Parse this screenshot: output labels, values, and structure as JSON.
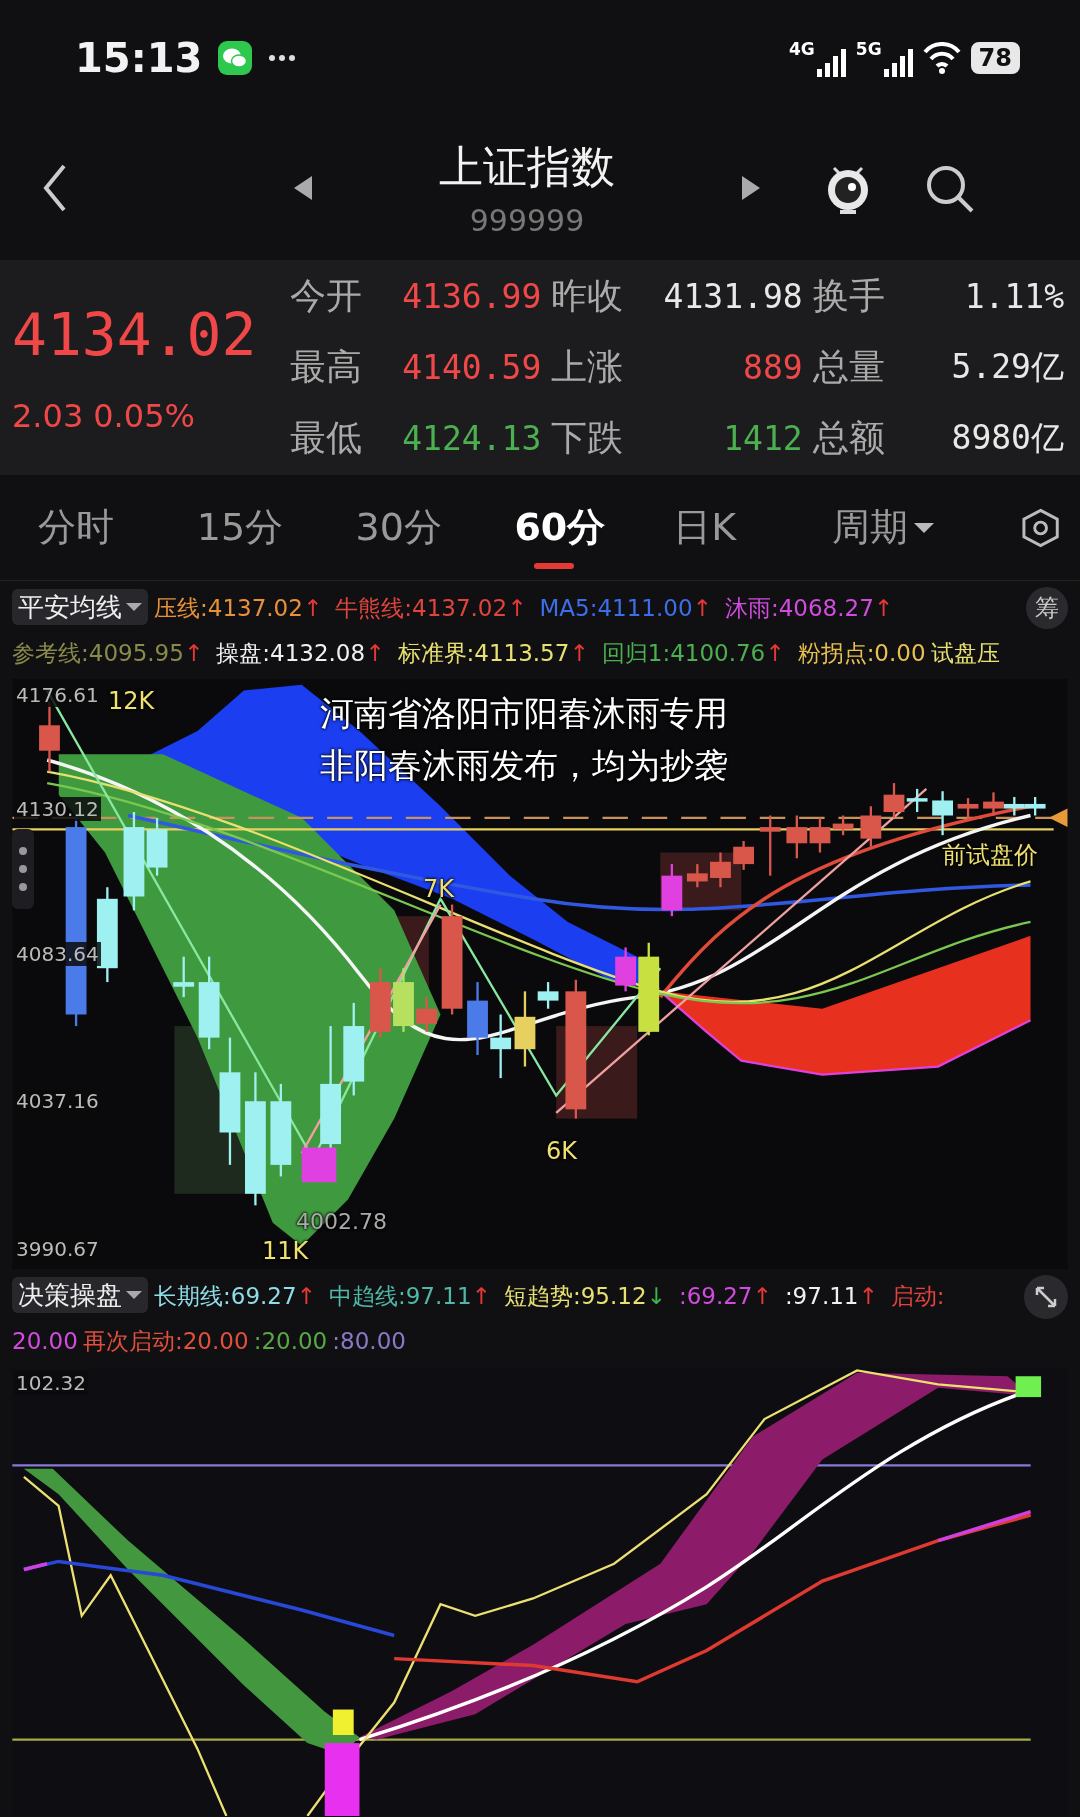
{
  "status_bar": {
    "time": "15:13",
    "network_1": "4G",
    "network_2": "5G",
    "battery": "78"
  },
  "header": {
    "title": "上证指数",
    "code": "999999"
  },
  "quote": {
    "price": "4134.02",
    "change": "2.03",
    "change_pct": "0.05%",
    "color": "#f04848",
    "stats": [
      {
        "label": "今开",
        "value": "4136.99",
        "color": "#f04848"
      },
      {
        "label": "昨收",
        "value": "4131.98",
        "color": "#e8e8e8"
      },
      {
        "label": "换手",
        "value": "1.11%",
        "color": "#e8e8e8"
      },
      {
        "label": "最高",
        "value": "4140.59",
        "color": "#f04848"
      },
      {
        "label": "上涨",
        "value": "889",
        "color": "#f04848"
      },
      {
        "label": "总量",
        "value": "5.29亿",
        "color": "#e8e8e8"
      },
      {
        "label": "最低",
        "value": "4124.13",
        "color": "#4caf50"
      },
      {
        "label": "下跌",
        "value": "1412",
        "color": "#4caf50"
      },
      {
        "label": "总额",
        "value": "8980亿",
        "color": "#e8e8e8"
      }
    ]
  },
  "period_tabs": [
    {
      "label": "分时",
      "kind": "plain",
      "selected": false
    },
    {
      "label": "15分",
      "kind": "plain",
      "selected": false
    },
    {
      "label": "30分",
      "kind": "plain",
      "selected": false
    },
    {
      "label": "60分",
      "kind": "plain",
      "selected": true
    },
    {
      "label": "日K",
      "kind": "plain",
      "selected": false
    },
    {
      "label": "周期",
      "kind": "dropdown",
      "selected": false
    }
  ],
  "main_indicator": {
    "name": "平安均线",
    "chip": "筹",
    "items": [
      {
        "text": "压线:4137.02",
        "color": "#e8913a",
        "arrow": {
          "text": "↑",
          "color": "#e53935"
        }
      },
      {
        "text": "牛熊线:4137.02",
        "color": "#e0443c",
        "arrow": {
          "text": "↑",
          "color": "#e53935"
        }
      },
      {
        "text": "MA5:4111.00",
        "color": "#3c6ee8",
        "arrow": {
          "text": "↑",
          "color": "#e53935"
        }
      },
      {
        "text": "沐雨:4068.27",
        "color": "#d24be0",
        "arrow": {
          "text": "↑",
          "color": "#e53935"
        }
      },
      {
        "text": "参考线:4095.95",
        "color": "#8a8a4a",
        "arrow": {
          "text": "↑",
          "color": "#e53935"
        }
      },
      {
        "text": "操盘:4132.08",
        "color": "#f0f0f0",
        "arrow": {
          "text": "↑",
          "color": "#e53935"
        }
      },
      {
        "text": "标准界:4113.57",
        "color": "#e8e070",
        "arrow": {
          "text": "↑",
          "color": "#e53935"
        }
      },
      {
        "text": "回归1:4100.76",
        "color": "#4caf50",
        "arrow": {
          "text": "↑",
          "color": "#e53935"
        }
      },
      {
        "text": "粉拐点:0.00",
        "color": "#e8c050"
      },
      {
        "text": "试盘压",
        "color": "#e8e070"
      }
    ],
    "chart": {
      "axis_labels": [
        "4176.61",
        "4130.12",
        "4083.64",
        "4037.16",
        "3990.67"
      ],
      "marks": [
        "12K",
        "7K",
        "6K",
        "11K"
      ],
      "low_label": "4002.78",
      "trial_price_label": "前试盘价",
      "overlay_text": [
        "河南省洛阳市阳春沐雨专用",
        "非阳春沐雨发布，均为抄袭"
      ]
    }
  },
  "sub_indicator": {
    "name": "决策操盘",
    "items": [
      {
        "text": "长期线:69.27",
        "color": "#8fdde8",
        "arrow": {
          "text": "↑",
          "color": "#e53935"
        }
      },
      {
        "text": "中趋线:97.11",
        "color": "#4fb8a8",
        "arrow": {
          "text": "↑",
          "color": "#e53935"
        }
      },
      {
        "text": "短趋势:95.12",
        "color": "#e8e070",
        "arrow": {
          "text": "↓",
          "color": "#3cb44b"
        }
      },
      {
        "text": ":69.27",
        "color": "#d24be0",
        "arrow": {
          "text": "↑",
          "color": "#e53935"
        }
      },
      {
        "text": ":97.11",
        "color": "#f0f0f0",
        "arrow": {
          "text": "↑",
          "color": "#e53935"
        }
      },
      {
        "text": "启动:",
        "color": "#e0443c"
      },
      {
        "text": "20.00",
        "color": "#d24be0"
      },
      {
        "text": "再次启动:20.00",
        "color": "#e0503c"
      },
      {
        "text": ":20.00",
        "color": "#58a848"
      },
      {
        "text": ":80.00",
        "color": "#8a78c8"
      }
    ],
    "chart": {
      "axis_labels": [
        "102.32"
      ]
    }
  }
}
